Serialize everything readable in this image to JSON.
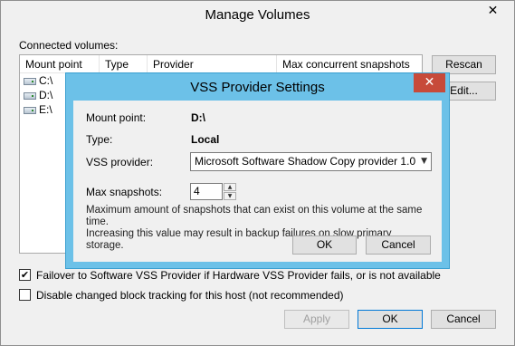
{
  "window": {
    "title": "Manage Volumes",
    "close_glyph": "✕"
  },
  "volumes": {
    "label": "Connected volumes:",
    "columns": [
      "Mount point",
      "Type",
      "Provider",
      "Max concurrent snapshots"
    ],
    "rows": [
      {
        "mount": "C:\\"
      },
      {
        "mount": "D:\\"
      },
      {
        "mount": "E:\\"
      }
    ]
  },
  "buttons": {
    "rescan": "Rescan",
    "edit": "Edit...",
    "apply": "Apply",
    "ok": "OK",
    "cancel": "Cancel"
  },
  "options": {
    "failover": {
      "label": "Failover to Software VSS Provider if Hardware VSS Provider fails, or is not available",
      "checked": true,
      "check_glyph": "✔"
    },
    "disable_cbt": {
      "label": "Disable changed block tracking for this host (not recommended)",
      "checked": false
    }
  },
  "dialog": {
    "title": "VSS Provider Settings",
    "close_glyph": "✕",
    "mount_point_label": "Mount point:",
    "mount_point_value": "D:\\",
    "type_label": "Type:",
    "type_value": "Local",
    "vss_provider_label": "VSS provider:",
    "vss_provider_value": "Microsoft Software Shadow Copy provider 1.0",
    "max_snapshots_label": "Max snapshots:",
    "max_snapshots_value": "4",
    "description_line1": "Maximum amount of snapshots that can exist on this volume at the same time.",
    "description_line2": "Increasing this value may result in backup failures on slow primary storage.",
    "ok": "OK",
    "cancel": "Cancel"
  }
}
